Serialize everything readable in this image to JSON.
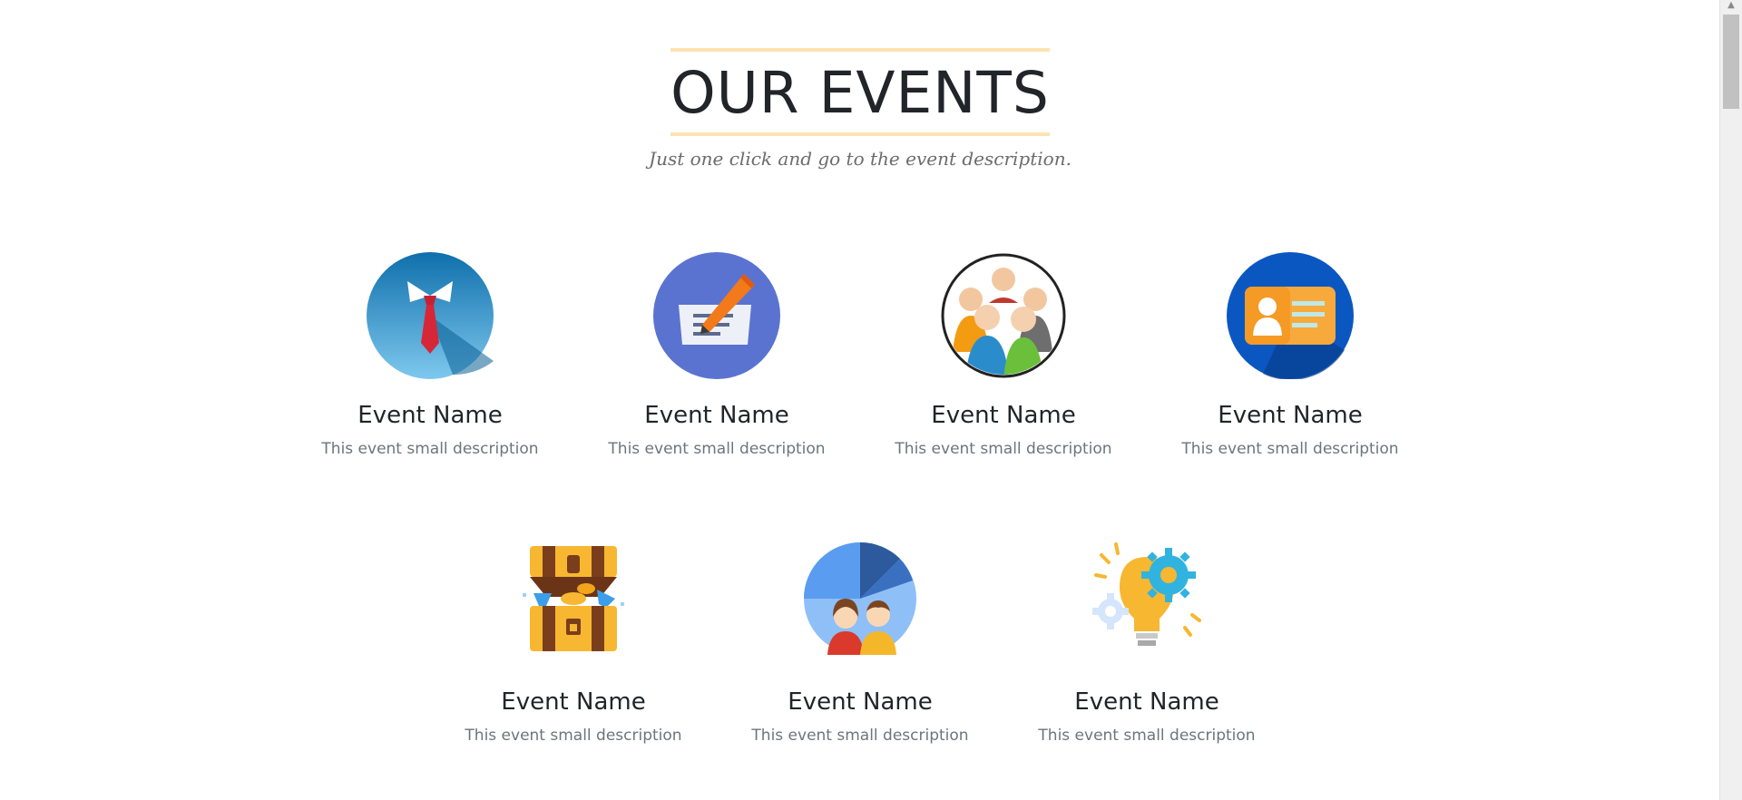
{
  "header": {
    "title": "OUR EVENTS",
    "subtitle": "Just one click and go to the event description."
  },
  "events": [
    {
      "name": "Event Name",
      "description": "This event small description",
      "icon": "business-tie-icon"
    },
    {
      "name": "Event Name",
      "description": "This event small description",
      "icon": "writing-pen-icon"
    },
    {
      "name": "Event Name",
      "description": "This event small description",
      "icon": "team-people-icon"
    },
    {
      "name": "Event Name",
      "description": "This event small description",
      "icon": "id-card-icon"
    },
    {
      "name": "Event Name",
      "description": "This event small description",
      "icon": "treasure-chest-icon"
    },
    {
      "name": "Event Name",
      "description": "This event small description",
      "icon": "pie-chart-people-icon"
    },
    {
      "name": "Event Name",
      "description": "This event small description",
      "icon": "idea-bulb-gears-icon"
    }
  ],
  "colors": {
    "title_border": "#fde3b2",
    "title_text": "#212529",
    "subtitle_text": "#6c6c6c",
    "description_text": "#6c757d"
  }
}
